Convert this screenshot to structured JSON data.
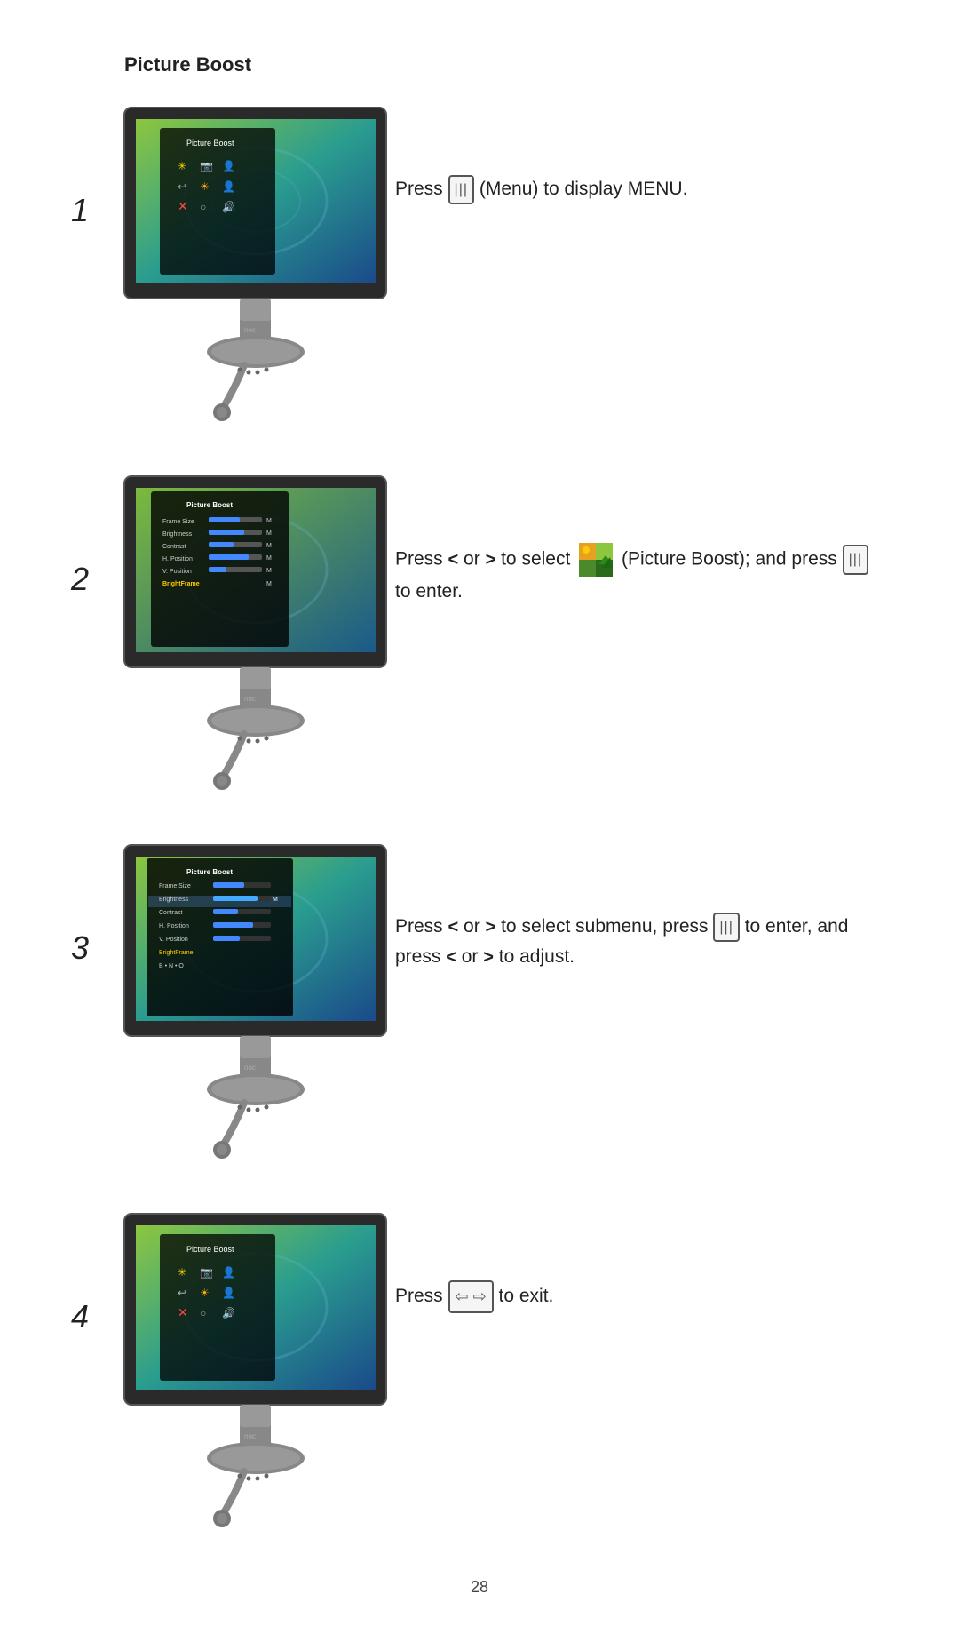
{
  "title": "Picture Boost",
  "steps": [
    {
      "number": "1",
      "instruction_parts": [
        "Press",
        " (Menu) to display MENU."
      ]
    },
    {
      "number": "2",
      "instruction_parts": [
        "Press",
        " or ",
        " to select",
        " (Picture Boost); and press",
        " to enter."
      ]
    },
    {
      "number": "3",
      "instruction_parts": [
        "Press",
        " or ",
        " to select submenu, press",
        " to enter, and press",
        " or ",
        " to adjust."
      ]
    },
    {
      "number": "4",
      "instruction_parts": [
        "Press",
        " to exit."
      ]
    }
  ],
  "page_number": "28"
}
